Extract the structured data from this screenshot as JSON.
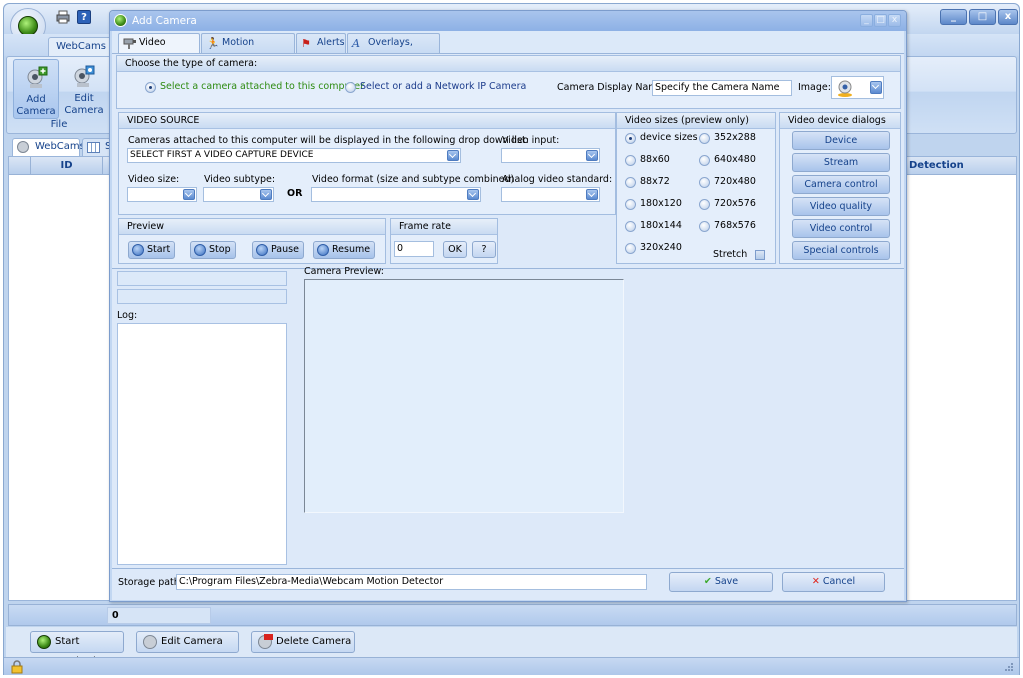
{
  "main_window": {
    "quick_access": {
      "print_icon": "printer-icon",
      "help_icon": "help-icon"
    },
    "ribbon_tab": "WebCams",
    "ribbon_buttons": [
      {
        "label_line1": "Add",
        "label_line2": "Camera",
        "icon": "add-camera-icon"
      },
      {
        "label_line1": "Edit",
        "label_line2": "Camera",
        "icon": "edit-camera-icon"
      }
    ],
    "ribbon_group": "File",
    "doc_tabs": [
      {
        "label": "WebCams",
        "icon": "webcam-icon"
      },
      {
        "label": "Sc",
        "icon": "schedule-icon"
      }
    ],
    "grid_columns": [
      "ID",
      "Detection"
    ],
    "footer_value": "0",
    "bottom_buttons": [
      {
        "label": "Start Monitoring",
        "icon": "start-monitoring-icon"
      },
      {
        "label": "Edit Camera",
        "icon": "edit-camera-icon"
      },
      {
        "label": "Delete Camera",
        "icon": "delete-camera-icon"
      }
    ],
    "window_controls": {
      "minimize": "_",
      "maximize": "□",
      "close": "x"
    }
  },
  "dialog": {
    "title": "Add Camera",
    "controls": {
      "minimize": "_",
      "maximize": "□",
      "close": "x"
    },
    "tabs": [
      {
        "label": "Video Source",
        "icon": "video-source-icon",
        "active": true
      },
      {
        "label": "Motion Detection",
        "icon": "motion-detection-icon"
      },
      {
        "label": "Alerts",
        "icon": "alerts-icon"
      },
      {
        "label": "Overlays, Labels",
        "icon": "overlays-icon"
      }
    ],
    "camera_type": {
      "heading": "Choose the type of camera:",
      "options": [
        {
          "label": "Select a camera attached to this computer",
          "selected": true,
          "color": "#2e8b12"
        },
        {
          "label": "Select or add a Network IP Camera",
          "selected": false,
          "color": "#1c3c8c"
        }
      ],
      "display_name_label": "Camera Display Name:",
      "display_name_value": "Specify the Camera Name",
      "image_label": "Image:"
    },
    "video_source": {
      "heading": "VIDEO SOURCE",
      "cameras_label": "Cameras attached to this computer will be displayed in the following drop down list:",
      "cameras_value": "SELECT FIRST A VIDEO CAPTURE DEVICE",
      "video_input_label": "Video input:",
      "video_size_label": "Video size:",
      "video_subtype_label": "Video subtype:",
      "or_label": "OR",
      "video_format_label": "Video format (size and subtype combined)",
      "analog_label": "Analog video standard:"
    },
    "preview": {
      "heading": "Preview",
      "buttons": [
        "Start",
        "Stop",
        "Pause",
        "Resume"
      ]
    },
    "frame_rate": {
      "heading": "Frame rate",
      "value": "0",
      "ok_label": "OK",
      "help_label": "?"
    },
    "video_sizes": {
      "heading": "Video sizes (preview only)",
      "col1": [
        {
          "label": "device sizes",
          "selected": true
        },
        {
          "label": "88x60"
        },
        {
          "label": "88x72"
        },
        {
          "label": "180x120"
        },
        {
          "label": "180x144"
        },
        {
          "label": "320x240"
        }
      ],
      "col2": [
        {
          "label": "352x288"
        },
        {
          "label": "640x480"
        },
        {
          "label": "720x480"
        },
        {
          "label": "720x576"
        },
        {
          "label": "768x576"
        }
      ],
      "stretch_label": "Stretch"
    },
    "device_dialogs": {
      "heading": "Video device dialogs",
      "buttons": [
        "Device",
        "Stream",
        "Camera control",
        "Video quality",
        "Video control",
        "Special controls"
      ]
    },
    "log_label": "Log:",
    "camera_preview_label": "Camera Preview:",
    "storage_path_label": "Storage path:",
    "storage_path_value": "C:\\Program Files\\Zebra-Media\\Webcam Motion Detector",
    "save_label": "Save",
    "cancel_label": "Cancel"
  }
}
